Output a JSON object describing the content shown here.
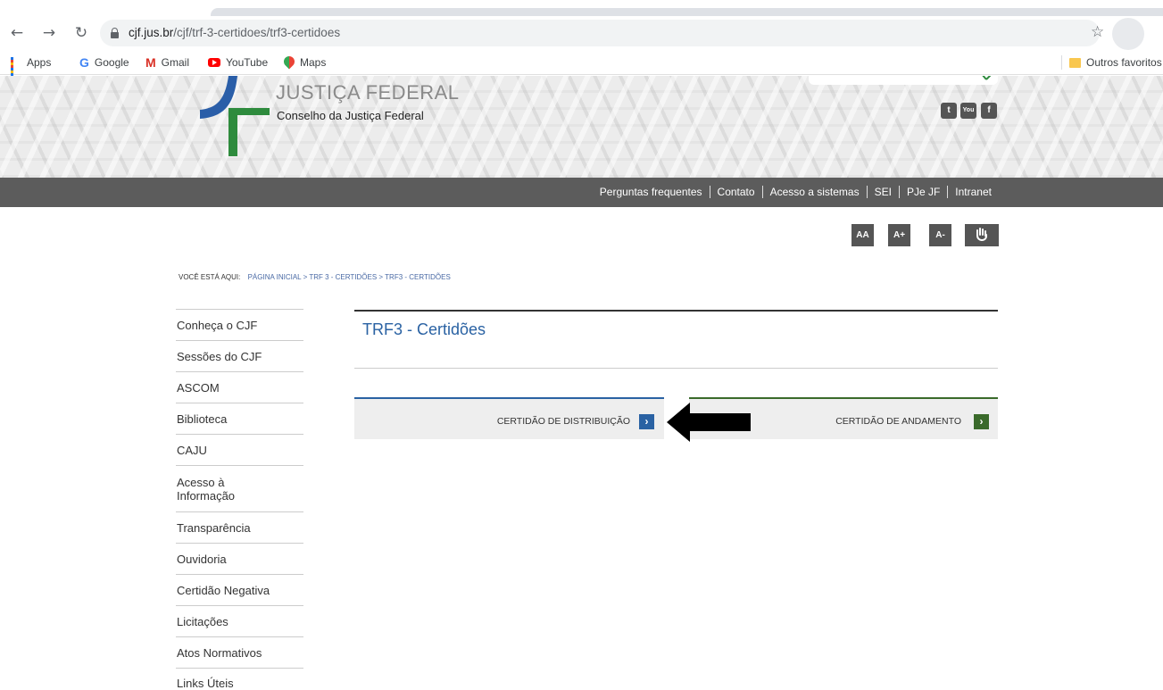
{
  "browser": {
    "url_host": "cjf.jus.br",
    "url_path": "/cjf/trf-3-certidoes/trf3-certidoes",
    "bookmarks": [
      "Apps",
      "Google",
      "Gmail",
      "YouTube",
      "Maps"
    ],
    "other_bookmarks": "Outros favoritos"
  },
  "header": {
    "brand_title": "JUSTIÇA FEDERAL",
    "brand_subtitle": "Conselho da Justiça Federal",
    "social_icons": [
      "twitter-icon",
      "youtube-icon",
      "facebook-icon"
    ],
    "social_glyphs": {
      "twitter": "t",
      "youtube": "You",
      "facebook": "f"
    }
  },
  "top_nav": [
    "Perguntas frequentes",
    "Contato",
    "Acesso a sistemas",
    "SEI",
    "PJe JF",
    "Intranet"
  ],
  "accessibility": [
    "AA",
    "A+",
    "A-"
  ],
  "breadcrumb": {
    "lead": "VOCÊ ESTÁ AQUI:",
    "items": [
      "PÁGINA INICIAL",
      ">",
      "TRF 3 - CERTIDÕES",
      ">",
      "TRF3 - CERTIDÕES"
    ]
  },
  "side_menu": [
    "Conheça o CJF",
    "Sessões do CJF",
    "ASCOM",
    "Biblioteca",
    "CAJU",
    "Acesso à Informação",
    "Transparência",
    "Ouvidoria",
    "Certidão Negativa",
    "Licitações",
    "Atos Normativos",
    "Links Úteis"
  ],
  "main": {
    "title": "TRF3 - Certidões",
    "tabs": [
      {
        "label": "CERTIDÃO DE DISTRIBUIÇÃO",
        "accent": "#2a62a3"
      },
      {
        "label": "CERTIDÃO DE ANDAMENTO",
        "accent": "#3a6a2b"
      }
    ],
    "chevron": "›"
  },
  "colors": {
    "nav_bar": "#5c5c5c",
    "title_blue": "#2a62a3",
    "logo_blue": "#2a5ea8",
    "logo_green": "#2e8b3d"
  }
}
